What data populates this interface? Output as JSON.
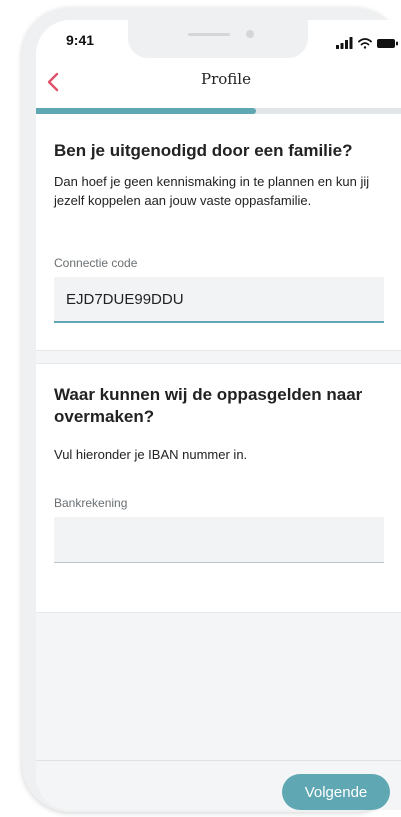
{
  "status_bar": {
    "time": "9:41",
    "icons": [
      "signal-icon",
      "wifi-icon",
      "battery-icon"
    ]
  },
  "header": {
    "back_icon": "chevron-left-icon",
    "title": "Profile"
  },
  "progress": {
    "value_percent": 58,
    "fill_color": "#5fa8b3"
  },
  "invite_section": {
    "title": "Ben je uitgenodigd door een familie?",
    "description": "Dan hoef je geen kennismaking in te plannen en kun jij jezelf koppelen aan jouw vaste oppasfamilie.",
    "field_label": "Connectie code",
    "field_value": "EJD7DUE99DDU"
  },
  "bank_section": {
    "title": "Waar kunnen wij de oppasgelden naar overmaken?",
    "description": "Vul hieronder je IBAN nummer in.",
    "field_label": "Bankrekening",
    "field_value": ""
  },
  "footer": {
    "next_label": "Volgende"
  },
  "colors": {
    "accent": "#5fa8b3",
    "back_arrow": "#e0516b"
  }
}
